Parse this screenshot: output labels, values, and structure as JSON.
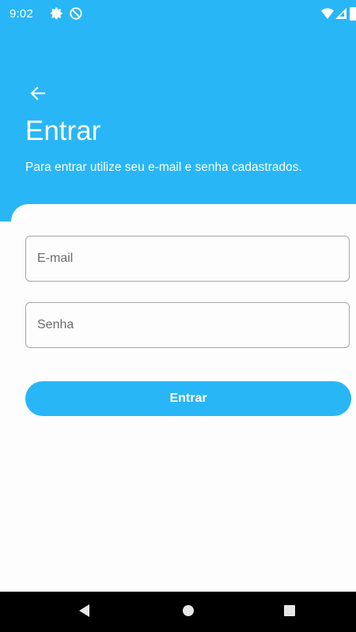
{
  "status_bar": {
    "time": "9:02",
    "icons": [
      "settings-icon",
      "do-not-disturb-icon",
      "wifi-icon",
      "signal-icon",
      "battery-icon"
    ]
  },
  "header": {
    "back_icon": "arrow-left-icon",
    "title": "Entrar",
    "subtitle": "Para entrar utilize seu e-mail e senha cadastrados."
  },
  "form": {
    "email": {
      "placeholder": "E-mail",
      "value": ""
    },
    "password": {
      "placeholder": "Senha",
      "value": ""
    },
    "submit_label": "Entrar"
  },
  "nav_bar": {
    "buttons": [
      "back-triangle-icon",
      "home-circle-icon",
      "recents-square-icon"
    ]
  },
  "colors": {
    "accent": "#29B6F6",
    "background": "#FDFDFD",
    "field_border": "#A5A5A5",
    "nav_background": "#000000"
  }
}
